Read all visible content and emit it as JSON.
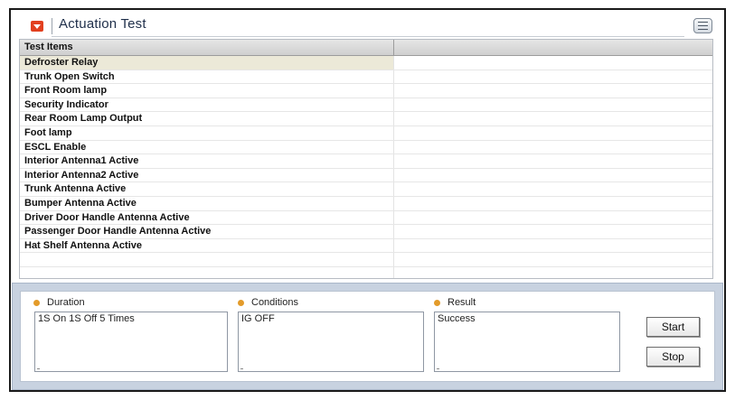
{
  "window": {
    "title": "Actuation Test"
  },
  "grid": {
    "header": "Test Items",
    "items": [
      "Defroster Relay",
      "Trunk Open Switch",
      "Front Room lamp",
      "Security Indicator",
      "Rear Room Lamp Output",
      "Foot lamp",
      "ESCL Enable",
      "Interior Antenna1 Active",
      "Interior Antenna2 Active",
      "Trunk Antenna Active",
      "Bumper Antenna Active",
      "Driver Door Handle Antenna Active",
      "Passenger Door Handle Antenna Active",
      "Hat Shelf Antenna Active"
    ],
    "selected_item": "Defroster Relay"
  },
  "details": {
    "duration_label": "Duration",
    "duration_value": "1S On 1S Off 5 Times",
    "conditions_label": "Conditions",
    "conditions_value": "IG OFF",
    "result_label": "Result",
    "result_value": "Success"
  },
  "buttons": {
    "start_label": "Start",
    "stop_label": "Stop"
  },
  "colors": {
    "accent_icon": "#e2401f",
    "label_dot": "#e39b2a",
    "panel_background": "#c8d2e0",
    "selected_row": "#ece9d8"
  }
}
